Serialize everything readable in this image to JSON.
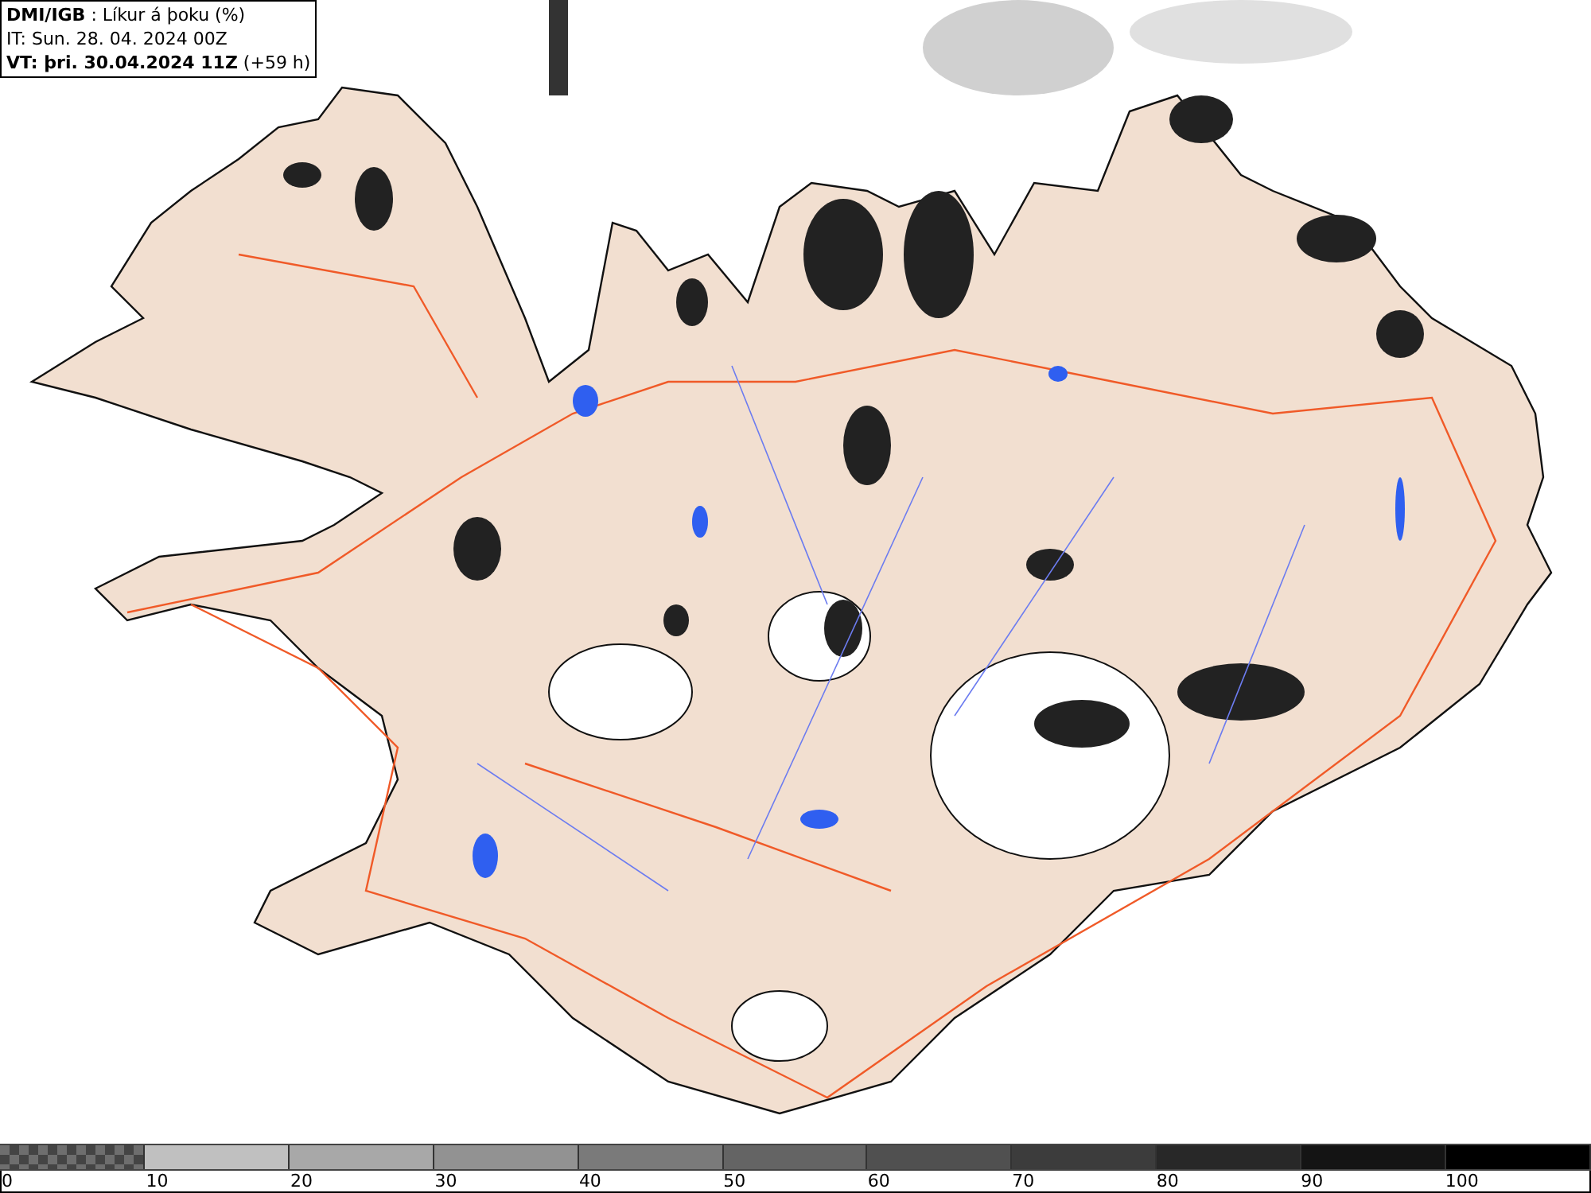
{
  "header": {
    "lines": [
      "**DMI/IGB** : Líkur á þoku (%)",
      "IT: Sun. 28. 04. 2024 00Z",
      "**VT: þri. 30.04.2024 11Z** (+59 h)"
    ]
  },
  "legend": {
    "bins": [
      {
        "kind": "pattern",
        "color": "#6e6e6e"
      },
      {
        "kind": "solid",
        "color": "#c0c0c0"
      },
      {
        "kind": "solid",
        "color": "#a8a8a8"
      },
      {
        "kind": "solid",
        "color": "#929292"
      },
      {
        "kind": "solid",
        "color": "#7a7a7a"
      },
      {
        "kind": "solid",
        "color": "#646464"
      },
      {
        "kind": "solid",
        "color": "#505050"
      },
      {
        "kind": "solid",
        "color": "#3c3c3c"
      },
      {
        "kind": "solid",
        "color": "#282828"
      },
      {
        "kind": "solid",
        "color": "#141414"
      },
      {
        "kind": "solid",
        "color": "#000000"
      }
    ],
    "labels": [
      "0",
      "10",
      "20",
      "30",
      "40",
      "50",
      "60",
      "70",
      "80",
      "90",
      "100"
    ]
  }
}
